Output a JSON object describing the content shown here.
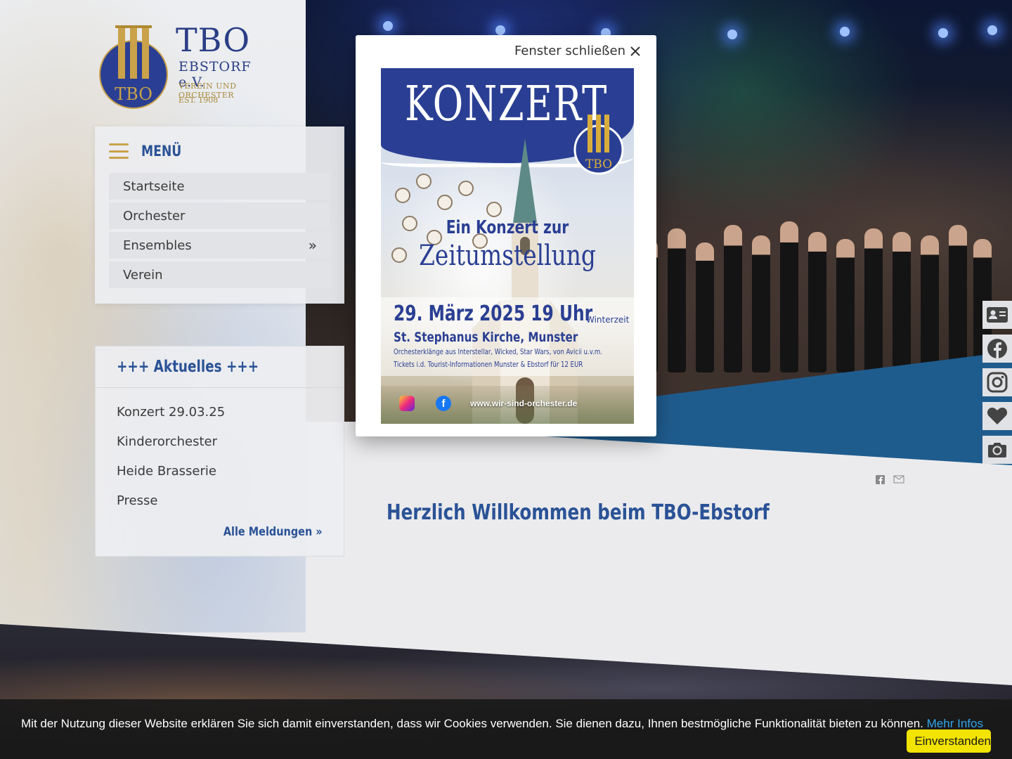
{
  "logo": {
    "title": "TBO",
    "subtitle": "EBSTORF e.V.",
    "tagline": "VEREIN UND ORCHESTER",
    "established": "EST. 1908",
    "emblem_text": "TBO"
  },
  "menu": {
    "label": "MENÜ",
    "items": [
      {
        "label": "Startseite",
        "arrow": ""
      },
      {
        "label": "Orchester",
        "arrow": ""
      },
      {
        "label": "Ensembles",
        "arrow": "»"
      },
      {
        "label": "Verein",
        "arrow": ""
      }
    ]
  },
  "news": {
    "title": "+++ Aktuelles +++",
    "items": [
      "Konzert 29.03.25",
      "Kinderorchester",
      "Heide Brasserie",
      "Presse"
    ],
    "all_link": "Alle Meldungen »"
  },
  "content": {
    "heading": "Herzlich Willkommen beim TBO-Ebstorf"
  },
  "share": {
    "facebook_icon": "facebook-icon",
    "email_icon": "email-icon"
  },
  "social": [
    "contact-card-icon",
    "facebook-icon",
    "instagram-icon",
    "heart-icon",
    "camera-icon"
  ],
  "modal": {
    "close_label": "Fenster schließen",
    "poster": {
      "headline": "KONZERT",
      "logo_text": "TBO",
      "line1": "Ein Konzert zur",
      "line2": "Zeitumstellung",
      "date": "29. März 2025 19 Uhr",
      "date_note": "Winterzeit",
      "place": "St. Stephanus Kirche, Munster",
      "desc1": "Orchesterklänge aus Interstellar, Wicked, Star Wars, von Avicii u.v.m.",
      "desc2": "Tickets i.d. Tourist-Informationen Munster & Ebstorf für 12 EUR",
      "fb_glyph": "f",
      "url": "www.wir-sind-orchester.de"
    }
  },
  "cookie": {
    "text": "Mit der Nutzung dieser Website erklären Sie sich damit einverstanden, dass wir Cookies verwenden. Sie dienen dazu, Ihnen bestmögliche Funktionalität bieten zu können.",
    "more_link": "Mehr Infos",
    "accept_button": "Einverstanden"
  },
  "colors": {
    "brand_blue": "#2a5296",
    "poster_blue": "#2a3f93",
    "gold": "#c9a24a",
    "cookie_button": "#f2e300",
    "cookie_link": "#32a5e8"
  }
}
